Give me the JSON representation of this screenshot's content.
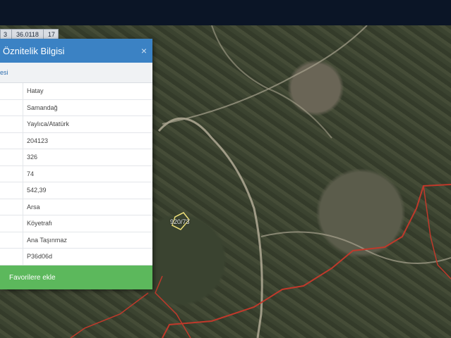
{
  "coordinates": {
    "value": "36.0118",
    "zoom": "17",
    "prefix": "3"
  },
  "parcel_label": "920/73",
  "panel": {
    "title": "Öznitelik Bilgisi",
    "close_symbol": "×",
    "subheader": "esi",
    "rows": [
      {
        "value": "Hatay"
      },
      {
        "value": "Samandağ"
      },
      {
        "value": "Yaylıca/Atatürk"
      },
      {
        "value": "204123"
      },
      {
        "value": "326"
      },
      {
        "value": "74"
      },
      {
        "value": "542,39"
      },
      {
        "value": "Arsa"
      },
      {
        "value": "Köyetrafı"
      },
      {
        "value": "Ana Taşınmaz"
      },
      {
        "value": "P36d06d"
      }
    ],
    "favorites_label": "Favorilere ekle"
  },
  "colors": {
    "header": "#3b82c4",
    "favorites": "#5cb85c",
    "topbar": "#0b1526",
    "parcel_border": "#c0392b"
  }
}
